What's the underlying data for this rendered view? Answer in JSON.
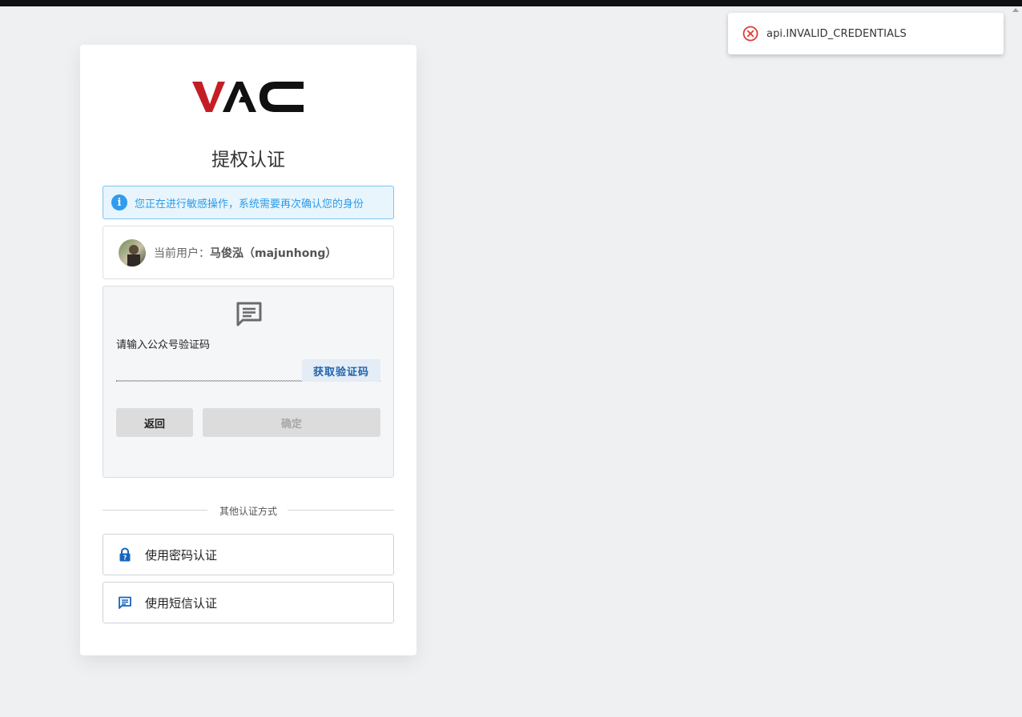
{
  "toast": {
    "message": "api.INVALID_CREDENTIALS",
    "icon": "error-circle-icon",
    "color": "#e53935"
  },
  "logo": {
    "text": "VAC",
    "accent_color": "#c41e25"
  },
  "page": {
    "title": "提权认证"
  },
  "alert": {
    "text": "您正在进行敏感操作，系统需要再次确认您的身份",
    "icon": "info-icon",
    "color": "#2f9cf0"
  },
  "user": {
    "label": "当前用户：",
    "name": "马俊泓（majunhong）"
  },
  "verify": {
    "icon": "message-icon",
    "input_label": "请输入公众号验证码",
    "input_value": "",
    "get_code_label": "获取验证码",
    "back_label": "返回",
    "confirm_label": "确定"
  },
  "other_methods": {
    "divider_text": "其他认证方式",
    "items": [
      {
        "label": "使用密码认证",
        "icon": "lock-icon"
      },
      {
        "label": "使用短信认证",
        "icon": "sms-icon"
      }
    ]
  }
}
